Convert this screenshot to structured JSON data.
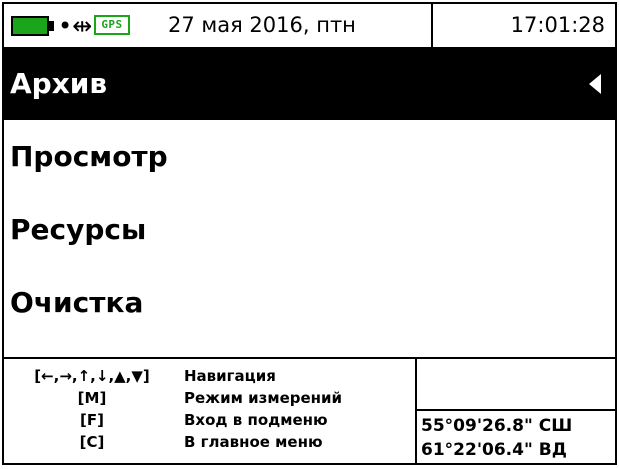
{
  "status_bar": {
    "battery_color": "#1aa51a",
    "usb_icon": "usb-icon",
    "gps_label": "GPS",
    "gps_color": "#1aa51a",
    "date": "27 мая 2016, птн",
    "time": "17:01:28"
  },
  "menu": {
    "items": [
      {
        "label": "Архив",
        "selected": true
      },
      {
        "label": "Просмотр",
        "selected": false
      },
      {
        "label": "Ресурсы",
        "selected": false
      },
      {
        "label": "Очистка",
        "selected": false
      }
    ],
    "selector_icon": "triangle-left-icon"
  },
  "help": {
    "rows": [
      {
        "key": "[←,→,↑,↓,▲,▼]",
        "desc": "Навигация"
      },
      {
        "key": "[M]",
        "desc": "Режим измерений"
      },
      {
        "key": "[F]",
        "desc": "Вход в подменю"
      },
      {
        "key": "[C]",
        "desc": "В главное меню"
      }
    ]
  },
  "coordinates": {
    "latitude": "55°09'26.8\" СШ",
    "longitude": "61°22'06.4\" ВД"
  }
}
